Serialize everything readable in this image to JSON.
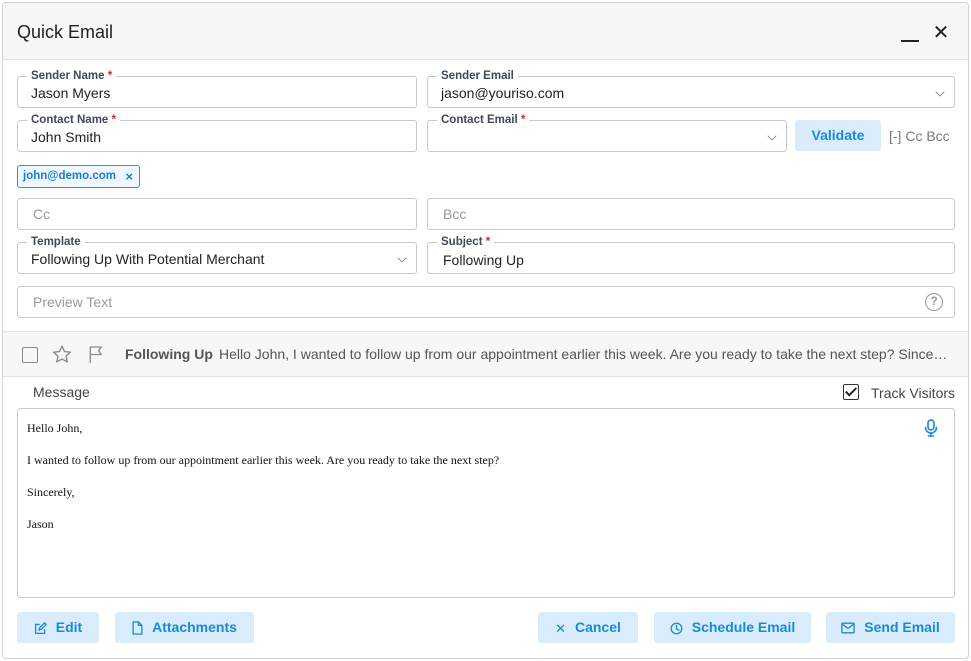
{
  "dialog": {
    "title": "Quick Email"
  },
  "sender_name": {
    "label": "Sender Name",
    "value": "Jason Myers"
  },
  "sender_email": {
    "label": "Sender Email",
    "value": "jason@youriso.com"
  },
  "contact_name": {
    "label": "Contact Name",
    "value": "John Smith"
  },
  "contact_email": {
    "label": "Contact Email",
    "value": ""
  },
  "required_marker": "*",
  "validate_label": "Validate",
  "cc_bcc_toggle": "[-] Cc Bcc",
  "recipient_chip": {
    "email": "john@demo.com",
    "remove": "×"
  },
  "cc": {
    "placeholder": "Cc"
  },
  "bcc": {
    "placeholder": "Bcc"
  },
  "template": {
    "label": "Template",
    "value": "Following Up With Potential Merchant"
  },
  "subject": {
    "label": "Subject",
    "value": "Following Up"
  },
  "preview_text": {
    "placeholder": "Preview Text",
    "help": "?"
  },
  "preview_bar": {
    "subject": "Following Up",
    "snippet": "Hello John, I wanted to follow up from our appointment earlier this week. Are you ready to take the next step? Sincerely, Jason"
  },
  "message": {
    "label": "Message",
    "track_visitors_label": "Track Visitors",
    "track_visitors_checked": true,
    "body": [
      "Hello John,",
      "I wanted to follow up from our appointment earlier this week. Are you ready to take the next step?",
      "Sincerely,",
      "Jason"
    ]
  },
  "buttons": {
    "edit": "Edit",
    "attachments": "Attachments",
    "cancel": "Cancel",
    "schedule": "Schedule Email",
    "send": "Send Email"
  },
  "colors": {
    "accent": "#1a8ad6",
    "button_bg": "#d8ecfb",
    "required": "#d9232e"
  }
}
